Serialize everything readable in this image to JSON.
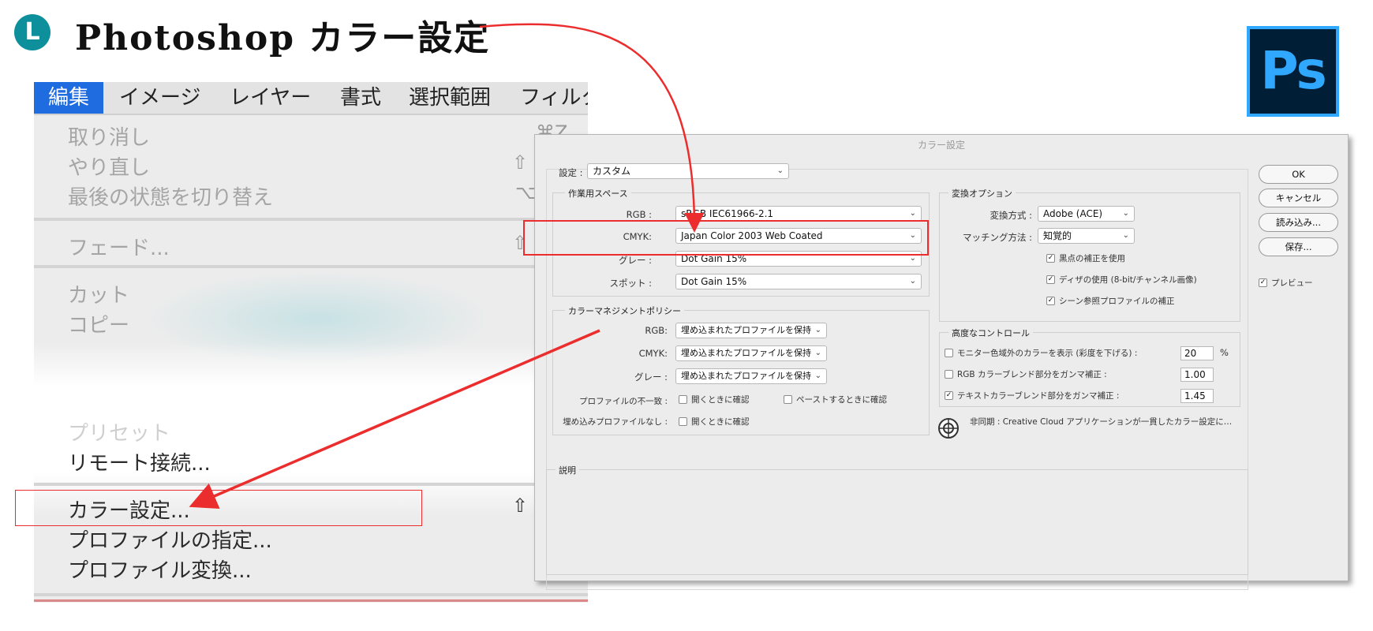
{
  "header": {
    "badge": "L",
    "title": "Photoshop カラー設定",
    "logo_text": "Ps"
  },
  "menubar": {
    "items": [
      "編集",
      "イメージ",
      "レイヤー",
      "書式",
      "選択範囲",
      "フィルタ"
    ]
  },
  "edit_menu": {
    "items": [
      {
        "label": "取り消し",
        "shortcut": "⌘Z"
      },
      {
        "label": "やり直し",
        "shortcut": "⇧"
      },
      {
        "label": "最後の状態を切り替え",
        "shortcut": "⌥"
      },
      {
        "label": "フェード...",
        "shortcut": "⇧"
      },
      {
        "label": "カット",
        "shortcut": ""
      },
      {
        "label": "コピー",
        "shortcut": ""
      },
      {
        "label": "プリセット",
        "shortcut": ""
      },
      {
        "label": "リモート接続...",
        "shortcut": ""
      },
      {
        "label": "カラー設定...",
        "shortcut": "⇧"
      },
      {
        "label": "プロファイルの指定...",
        "shortcut": ""
      },
      {
        "label": "プロファイル変換...",
        "shortcut": ""
      }
    ]
  },
  "dialog": {
    "title": "カラー設定",
    "settings_label": "設定 :",
    "settings_value": "カスタム",
    "workspace": {
      "group_label": "作業用スペース",
      "rows": [
        {
          "label": "RGB :",
          "value": "sRGB IEC61966-2.1"
        },
        {
          "label": "CMYK:",
          "value": "Japan Color 2003 Web Coated"
        },
        {
          "label": "グレー :",
          "value": "Dot Gain 15%"
        },
        {
          "label": "スポット :",
          "value": "Dot Gain 15%"
        }
      ]
    },
    "policy": {
      "group_label": "カラーマネジメントポリシー",
      "rows": [
        {
          "label": "RGB:",
          "value": "埋め込まれたプロファイルを保持"
        },
        {
          "label": "CMYK:",
          "value": "埋め込まれたプロファイルを保持"
        },
        {
          "label": "グレー :",
          "value": "埋め込まれたプロファイルを保持"
        }
      ],
      "mismatch_label": "プロファイルの不一致 :",
      "mismatch_open": "開くときに確認",
      "mismatch_paste": "ペーストするときに確認",
      "missing_label": "埋め込みプロファイルなし :",
      "missing_open": "開くときに確認"
    },
    "conversion": {
      "group_label": "変換オプション",
      "engine_label": "変換方式 :",
      "engine_value": "Adobe (ACE)",
      "intent_label": "マッチング方法 :",
      "intent_value": "知覚的",
      "checks": [
        {
          "label": "黒点の補正を使用",
          "checked": true
        },
        {
          "label": "ディザの使用 (8-bit/チャンネル画像)",
          "checked": true
        },
        {
          "label": "シーン参照プロファイルの補正",
          "checked": true
        }
      ]
    },
    "advanced": {
      "group_label": "高度なコントロール",
      "rows": [
        {
          "label": "モニター色域外のカラーを表示 (彩度を下げる) :",
          "value": "20",
          "unit": "%",
          "checked": false
        },
        {
          "label": "RGB カラーブレンド部分をガンマ補正 :",
          "value": "1.00",
          "unit": "",
          "checked": false
        },
        {
          "label": "テキストカラーブレンド部分をガンマ補正 :",
          "value": "1.45",
          "unit": "",
          "checked": true
        }
      ]
    },
    "sync_text": "非同期 : Creative Cloud アプリケーションが一貫したカラー設定に…",
    "description_label": "説明",
    "buttons": {
      "ok": "OK",
      "cancel": "キャンセル",
      "load": "読み込み...",
      "save": "保存..."
    },
    "preview_label": "プレビュー",
    "preview_checked": true
  },
  "colors": {
    "badge": "#0e8f9c",
    "menu_active": "#1f6ce0",
    "highlight": "#ec2d2d",
    "ps_bg": "#001e36",
    "ps_accent": "#31a8ff"
  }
}
